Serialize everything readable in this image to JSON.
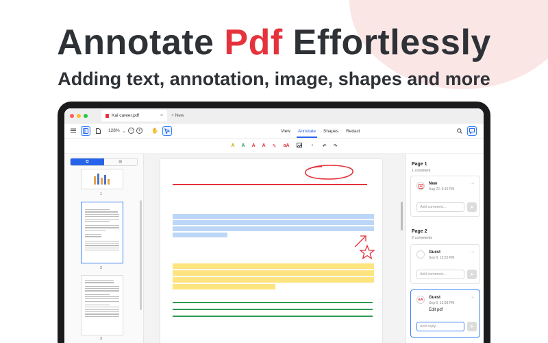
{
  "hero": {
    "title_part1": "Annotate ",
    "title_accent": "Pdf",
    "title_part2": " Effortlessly",
    "subtitle": "Adding text, annotation, image, shapes and more"
  },
  "window": {
    "tab_title": "Kai career.pdf",
    "new_tab_label": "+ New"
  },
  "toolbar": {
    "zoom_value": "128%",
    "menu": [
      "View",
      "Annotate",
      "Shapes",
      "Redact"
    ],
    "selected_menu": "Annotate"
  },
  "sidebar": {
    "page_numbers": [
      "1",
      "2",
      "3"
    ]
  },
  "comments": {
    "page1": {
      "heading": "Page 1",
      "count": "1 comment",
      "items": [
        {
          "author": "New",
          "date": "Aug 22, 5:16 PM",
          "input_placeholder": "Add comment..."
        }
      ]
    },
    "page2": {
      "heading": "Page 2",
      "count": "2 comments",
      "items": [
        {
          "author": "Guest",
          "date": "Sep 8, 12:55 PM",
          "input_placeholder": "Add comment..."
        },
        {
          "author": "Guest",
          "date": "Sep 8, 12:58 PM",
          "text": "Edit pdf",
          "input_placeholder": "Add reply..."
        }
      ]
    }
  },
  "colors": {
    "accent_red": "#e5323b",
    "brand_blue": "#2563eb",
    "highlight_blue": "#bcd6f7",
    "highlight_yellow": "#fde47f",
    "underline_green": "#2e9a52",
    "strike_red": "#e5323b"
  }
}
